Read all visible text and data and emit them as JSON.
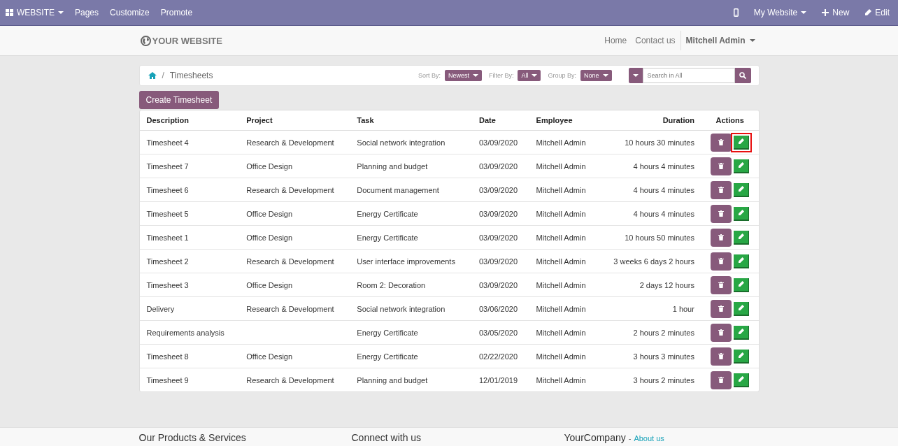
{
  "topbar": {
    "app_menu": "WEBSITE",
    "menu": [
      "Pages",
      "Customize",
      "Promote"
    ],
    "website_menu": "My Website",
    "new": "New",
    "edit": "Edit"
  },
  "header": {
    "logo": "YOUR WEBSITE",
    "links": [
      "Home",
      "Contact us"
    ],
    "user": "Mitchell Admin"
  },
  "breadcrumb": {
    "separator": "/",
    "current": "Timesheets"
  },
  "filters": [
    {
      "label": "Sort By:",
      "value": "Newest"
    },
    {
      "label": "Filter By:",
      "value": "All"
    },
    {
      "label": "Group By:",
      "value": "None"
    }
  ],
  "search": {
    "placeholder": "Search in All"
  },
  "create_button": "Create Timesheet",
  "table": {
    "columns": [
      "Description",
      "Project",
      "Task",
      "Date",
      "Employee",
      "Duration",
      "Actions"
    ],
    "rows": [
      {
        "cells": [
          "Timesheet 4",
          "Research & Development",
          "Social network integration",
          "03/09/2020",
          "Mitchell Admin",
          "10 hours 30 minutes"
        ],
        "highlighted": true
      },
      {
        "cells": [
          "Timesheet 7",
          "Office Design",
          "Planning and budget",
          "03/09/2020",
          "Mitchell Admin",
          "4 hours 4 minutes"
        ],
        "highlighted": false
      },
      {
        "cells": [
          "Timesheet 6",
          "Research & Development",
          "Document management",
          "03/09/2020",
          "Mitchell Admin",
          "4 hours 4 minutes"
        ],
        "highlighted": false
      },
      {
        "cells": [
          "Timesheet 5",
          "Office Design",
          "Energy Certificate",
          "03/09/2020",
          "Mitchell Admin",
          "4 hours 4 minutes"
        ],
        "highlighted": false
      },
      {
        "cells": [
          "Timesheet 1",
          "Office Design",
          "Energy Certificate",
          "03/09/2020",
          "Mitchell Admin",
          "10 hours 50 minutes"
        ],
        "highlighted": false
      },
      {
        "cells": [
          "Timesheet 2",
          "Research & Development",
          "User interface improvements",
          "03/09/2020",
          "Mitchell Admin",
          "3 weeks 6 days 2 hours"
        ],
        "highlighted": false
      },
      {
        "cells": [
          "Timesheet 3",
          "Office Design",
          "Room 2: Decoration",
          "03/09/2020",
          "Mitchell Admin",
          "2 days 12 hours"
        ],
        "highlighted": false
      },
      {
        "cells": [
          "Delivery",
          "Research & Development",
          "Social network integration",
          "03/06/2020",
          "Mitchell Admin",
          "1 hour"
        ],
        "highlighted": false
      },
      {
        "cells": [
          "Requirements analysis",
          "",
          "Energy Certificate",
          "03/05/2020",
          "Mitchell Admin",
          "2 hours 2 minutes"
        ],
        "highlighted": false
      },
      {
        "cells": [
          "Timesheet 8",
          "Office Design",
          "Energy Certificate",
          "02/22/2020",
          "Mitchell Admin",
          "3 hours 3 minutes"
        ],
        "highlighted": false
      },
      {
        "cells": [
          "Timesheet 9",
          "Research & Development",
          "Planning and budget",
          "12/01/2019",
          "Mitchell Admin",
          "3 hours 2 minutes"
        ],
        "highlighted": false
      }
    ]
  },
  "footer": {
    "columns": [
      "Our Products & Services",
      "Connect with us",
      "YourCompany"
    ],
    "separator": "-",
    "about_link": "About us"
  }
}
